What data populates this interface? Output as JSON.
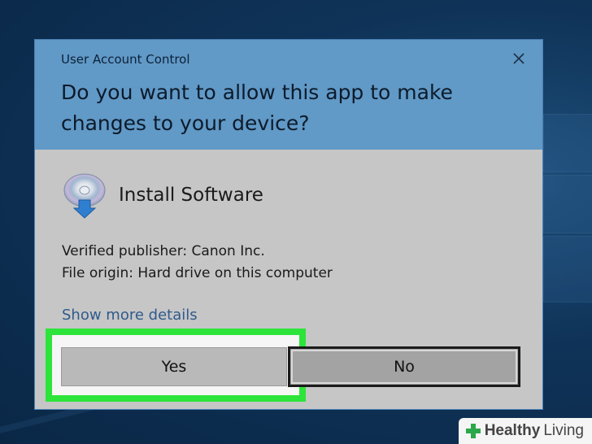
{
  "dialog": {
    "caption": "User Account Control",
    "question": "Do you want to allow this app to make changes to your device?",
    "app_name": "Install Software",
    "publisher_line": "Verified publisher: Canon Inc.",
    "origin_line": "File origin: Hard drive on this computer",
    "more_details": "Show more details",
    "yes_label": "Yes",
    "no_label": "No",
    "close_icon": "close-icon"
  },
  "watermark": {
    "part1": "Healthy",
    "part2": "Living"
  },
  "colors": {
    "header": "#6199c7",
    "dialog_body": "#c6c6c6",
    "highlight": "#2de43a",
    "link": "#2f5a8c"
  }
}
